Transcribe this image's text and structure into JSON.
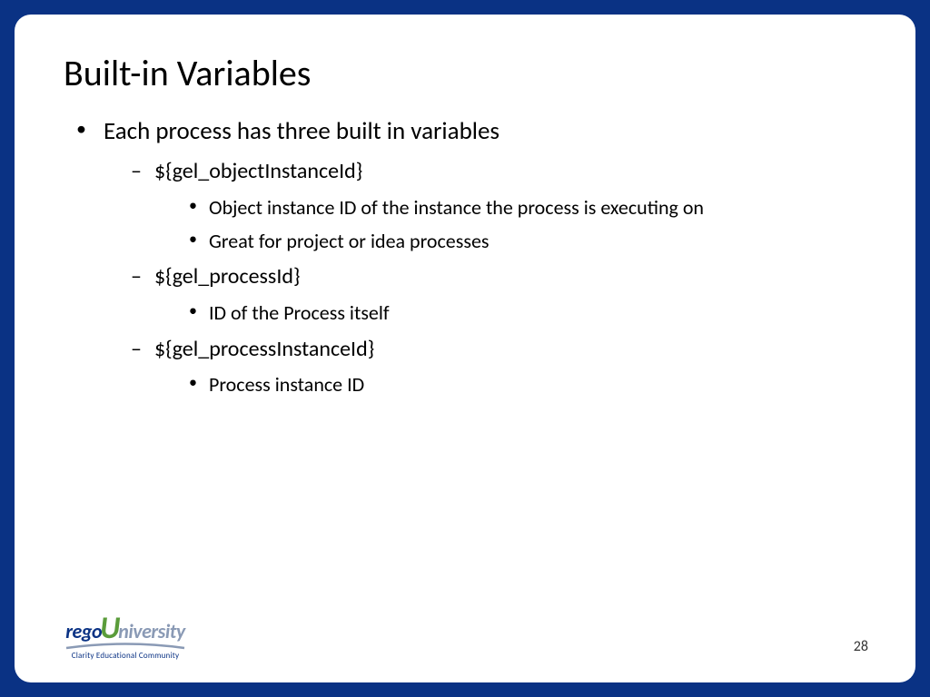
{
  "title": "Built-in Variables",
  "bullets": {
    "level1_item": "Each process has three built in variables",
    "var1": {
      "name": "${gel_objectInstanceId}",
      "desc1": "Object instance ID of the instance the process is executing on",
      "desc2": "Great for project or idea processes"
    },
    "var2": {
      "name": "${gel_processId}",
      "desc1": "ID of the Process itself"
    },
    "var3": {
      "name": "${gel_processInstanceId}",
      "desc1": "Process instance ID"
    }
  },
  "logo": {
    "rego": "rego",
    "u": "U",
    "niversity": "niversity",
    "tagline": "Clarity Educational Community"
  },
  "page_number": "28"
}
